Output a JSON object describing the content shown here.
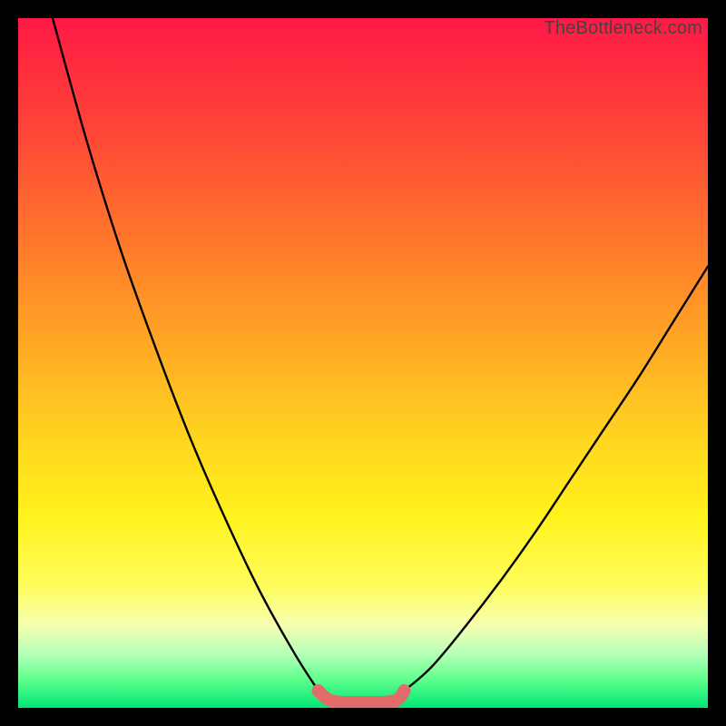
{
  "watermark": "TheBottleneck.com",
  "chart_data": {
    "type": "line",
    "title": "",
    "xlabel": "",
    "ylabel": "",
    "xlim": [
      0,
      100
    ],
    "ylim": [
      0,
      100
    ],
    "series": [
      {
        "name": "left-curve",
        "x": [
          5,
          10,
          15,
          20,
          25,
          30,
          35,
          40,
          43.5
        ],
        "y": [
          100,
          82,
          66,
          52,
          39,
          27.5,
          17,
          8,
          2.5
        ]
      },
      {
        "name": "right-curve",
        "x": [
          56,
          60,
          65,
          70,
          75,
          80,
          85,
          90,
          95,
          100
        ],
        "y": [
          2.5,
          6,
          12,
          18.5,
          25.5,
          33,
          40.5,
          48,
          56,
          64
        ]
      },
      {
        "name": "trough-highlight",
        "x": [
          43.5,
          45,
          47,
          50,
          53,
          55,
          56
        ],
        "y": [
          2.5,
          1.2,
          0.8,
          0.8,
          0.8,
          1.2,
          2.5
        ],
        "stroke": "#e26b6b",
        "width": 14
      }
    ],
    "gradient_stops": [
      {
        "pos": 0,
        "color": "#ff1846"
      },
      {
        "pos": 18,
        "color": "#ff4a36"
      },
      {
        "pos": 38,
        "color": "#ff8a28"
      },
      {
        "pos": 60,
        "color": "#ffd220"
      },
      {
        "pos": 82,
        "color": "#fffd5a"
      },
      {
        "pos": 92,
        "color": "#b8ffb8"
      },
      {
        "pos": 100,
        "color": "#00e676"
      }
    ]
  }
}
